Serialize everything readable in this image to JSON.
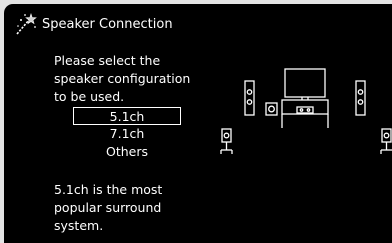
{
  "title": "Speaker Connection",
  "prompt": [
    "Please select the",
    "speaker configuration",
    "to be used."
  ],
  "options": [
    {
      "label": "5.1ch",
      "selected": true
    },
    {
      "label": "7.1ch",
      "selected": false
    },
    {
      "label": "Others",
      "selected": false
    }
  ],
  "description": [
    "5.1ch is the most",
    "popular surround",
    "system."
  ],
  "icons": {
    "title": "magic-wand-icon",
    "diagram": "speaker-layout-icon"
  },
  "colors": {
    "background": "#000000",
    "text": "#ffffff",
    "frame": "#e3e3e3"
  }
}
